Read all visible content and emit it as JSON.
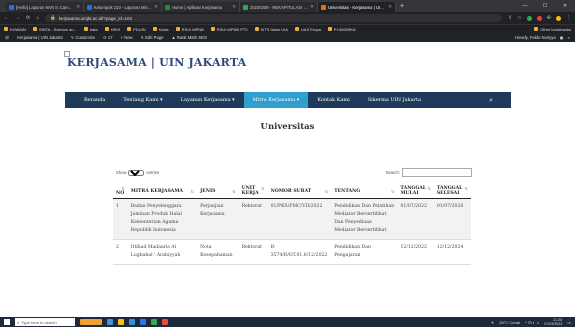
{
  "browser": {
    "tabs": [
      {
        "title": "[Hello] Laporan KKN in Campu...",
        "color": "#1a73e8",
        "active": false
      },
      {
        "title": "Kelompok 210 - Laporan Mingg...",
        "color": "#1a73e8",
        "active": false
      },
      {
        "title": "Home | Aplikasi Kerjasama",
        "color": "#1e8e3e",
        "active": false
      },
      {
        "title": "20230209 - REKAPITULASI MOU",
        "color": "#34a853",
        "active": false
      },
      {
        "title": "Universitas - Kerjasama | UIN Ja...",
        "color": "#e8710a",
        "active": true
      }
    ],
    "new_tab": "+",
    "url": "kerjasama.uinjkt.ac.id/?page_id=104",
    "bookmarks": [
      "KUWAIN",
      "SINTA - Science an...",
      "bafa",
      "HRIS",
      "PDUIN",
      "Kelas",
      "RSUI MPNB",
      "RSUI MPNB PT2",
      "SITS Islam UIA",
      "UAS Eropa",
      "PI AMDRKA"
    ],
    "other_bookmarks": "Other bookmarks"
  },
  "wpadmin": {
    "items": [
      "Kerjasama | UIN Jakarta",
      "Customize",
      "17",
      "+ New",
      "Edit Page",
      "Rank Math SEO"
    ],
    "greeting": "Howdy, Faldo Nuriyya"
  },
  "site": {
    "logo": "KERJASAMA | UIN JAKARTA",
    "nav": [
      "Beranda",
      "Tentang Kami ▾",
      "Layanan Kerjasama ▾",
      "Mitra Kerjasama ▾",
      "Kontak Kami",
      "Sikerma UIN Jakarta"
    ],
    "active_nav": 3,
    "page_title": "Universitas"
  },
  "table_controls": {
    "show_label": "Show",
    "entries_value": "10",
    "entries_label": "entries",
    "search_label": "Search:"
  },
  "table": {
    "headers": [
      "NO",
      "MITRA KERJASAMA",
      "JENIS",
      "UNIT KERJA",
      "NOMOR SURAT",
      "TENTANG",
      "TANGGAL MULAI",
      "TANGGAL SELESAI"
    ],
    "rows": [
      [
        "1",
        "Badan Penyelenggara Jaminan Produk Halal Kementerian Agama Republik Indonesia",
        "Perjanjian Kerjasama",
        "Rektorat",
        "01/PKS/FMC/VII/2022",
        "Pendidikan Dan Pelatihan Mediator Bersertifikat Dan Penyediaan Mediator Bersertifikat",
        "01/07/2022",
        "01/07/2026"
      ],
      [
        "2",
        "Ittihad Madaaris Al Lughahal ' Arabiyyah",
        "Nota Kesepahaman",
        "Rektorat",
        "B-3574/R/OT.01.6/12/2022",
        "Pendidikan Dan Pengajaran",
        "12/12/2022",
        "12/12/2024"
      ]
    ]
  },
  "taskbar": {
    "search_placeholder": "Type here to search",
    "weather": "28°C Cerah",
    "time": "21:25",
    "date": "07/03/2023"
  }
}
